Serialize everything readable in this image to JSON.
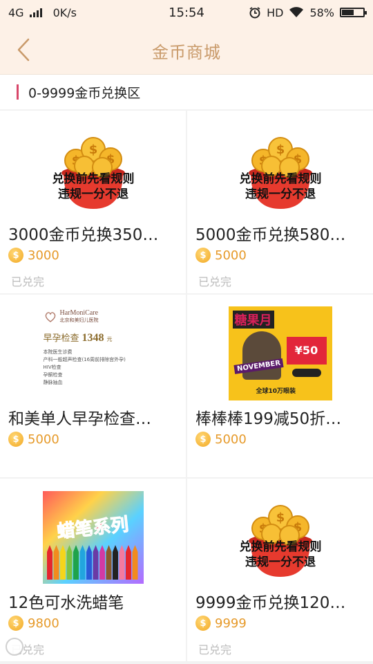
{
  "status_bar": {
    "network": "4G",
    "speed": "0K/s",
    "time": "15:54",
    "hd": "HD",
    "battery": "58%",
    "battery_level": 0.58
  },
  "header": {
    "title": "金币商城"
  },
  "section": {
    "title": "0-9999金币兑换区"
  },
  "coin_glyph": "$",
  "colors": {
    "accent": "#c99a6a",
    "section_bar": "#d8476a",
    "price": "#e69a2a",
    "status_muted": "#bbbbbb",
    "coin": "#f2a823"
  },
  "items": [
    {
      "name": "3000金币兑换350…",
      "price": "3000",
      "status": "已兑完",
      "image": "coin-pot-rules",
      "img_line1": "兑换前先看规则",
      "img_line2": "违规一分不退"
    },
    {
      "name": "5000金币兑换580…",
      "price": "5000",
      "status": "已兑完",
      "image": "coin-pot-rules",
      "img_line1": "兑换前先看规则",
      "img_line2": "违规一分不退"
    },
    {
      "name": "和美单人早孕检查…",
      "price": "5000",
      "status": "",
      "image": "harmonicare-flyer",
      "img_brand": "HarMoniCare",
      "img_brand_cn": "北京和美妇儿医院",
      "img_offer": "早孕检查",
      "img_price": "1348",
      "img_unit": "元",
      "img_list": [
        "本院医生诊费",
        "产科一般超声检查(16周前排除宫外孕)",
        "HIV检查",
        "孕酮检查",
        "静脉抽血"
      ]
    },
    {
      "name": "棒棒棒199减50折…",
      "price": "5000",
      "status": "",
      "image": "promo-poster",
      "img_title": "糖果月",
      "img_month": "NOVEMBER",
      "img_big": "¥50",
      "img_footer": "全球10万眼装"
    },
    {
      "name": "12色可水洗蜡笔",
      "price": "9800",
      "status": "已兑完",
      "image": "crayons-box",
      "img_title": "蜡笔系列"
    },
    {
      "name": "9999金币兑换120…",
      "price": "9999",
      "status": "已兑完",
      "image": "coin-pot-rules",
      "img_line1": "兑换前先看规则",
      "img_line2": "违规一分不退"
    }
  ]
}
